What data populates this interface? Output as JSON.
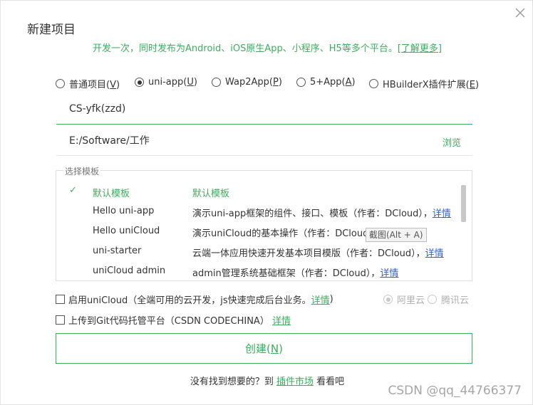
{
  "dialog": {
    "title": "新建项目",
    "intro_text": "开发一次，同时发布为Android、iOS原生App、小程序、H5等多个平台。",
    "intro_link": "[了解更多]"
  },
  "project_types": [
    {
      "label": "普通项目(",
      "key": "V",
      "selected": false
    },
    {
      "label": "uni-app(",
      "key": "U",
      "selected": true
    },
    {
      "label": "Wap2App(",
      "key": "P",
      "selected": false
    },
    {
      "label": "5+App(",
      "key": "A",
      "selected": false
    },
    {
      "label": "HBuilderX插件扩展(",
      "key": "E",
      "selected": false
    }
  ],
  "form": {
    "project_name": "CS-yfk(zzd)",
    "project_path": "E:/Software/工作",
    "browse_label": "浏览"
  },
  "templates": {
    "legend": "选择模板",
    "selected_mark": "✓",
    "items": [
      {
        "name": "默认模板",
        "desc": "默认模板",
        "link": "",
        "active": true
      },
      {
        "name": "Hello uni-app",
        "desc": "演示uni-app框架的组件、接口、模板（作者：DCloud），",
        "link": "详情",
        "active": false
      },
      {
        "name": "Hello uniCloud",
        "desc": "演示uniCloud的基本操作（作者：DCloud",
        "link": "",
        "active": false
      },
      {
        "name": "uni-starter",
        "desc": "云端一体应用快速开发基本项目模版（作者：DCloud），",
        "link": "详情",
        "active": false
      },
      {
        "name": "uniCloud admin",
        "desc": "admin管理系统基础框架（作者：DCloud），",
        "link": "详情",
        "active": false
      }
    ],
    "tooltip": "截图(Alt + A)"
  },
  "options": {
    "unicloud_label": "启用uniCloud（全端可用的云开发，js快速完成后台业务。",
    "unicloud_link": "详情",
    "unicloud_suffix": ")",
    "providers": [
      "阿里云",
      "腾讯云"
    ],
    "git_label": "上传到Git代码托管平台（CSDN CODECHINA）",
    "git_link": "详情"
  },
  "actions": {
    "create_label": "创建(",
    "create_key": "N",
    "create_suffix": ")"
  },
  "footer": {
    "prefix": "没有找到想要的？到 ",
    "link": "插件市场",
    "suffix": " 看看吧"
  },
  "watermark": "CSDN @qq_44766377",
  "colors": {
    "accent": "#3cae5c",
    "link": "#2f5fd8",
    "border": "#dedede"
  }
}
